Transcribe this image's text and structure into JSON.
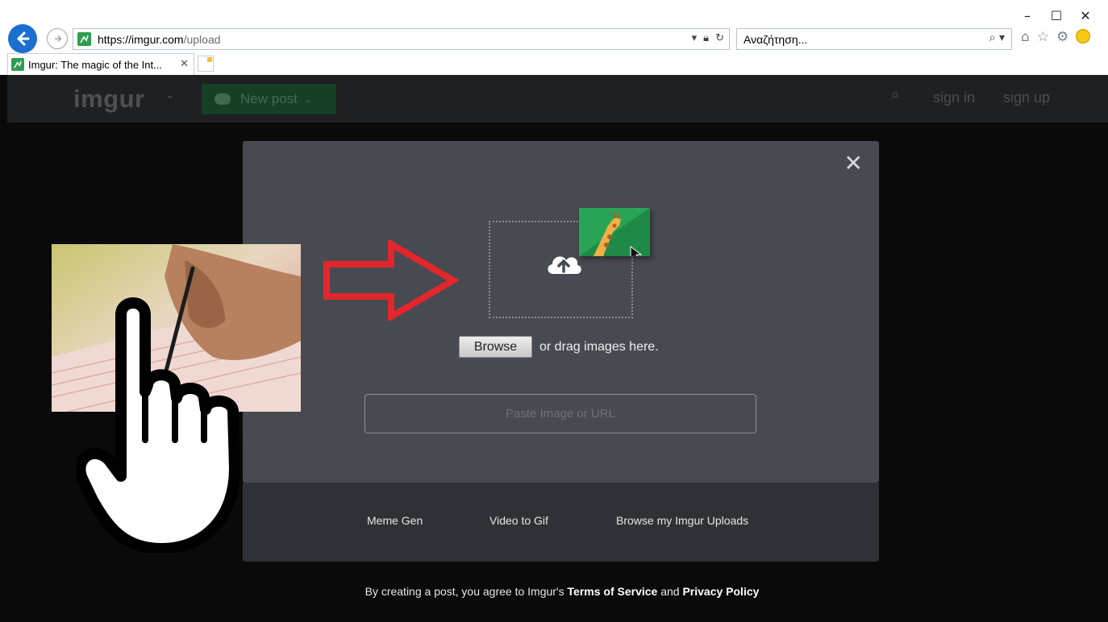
{
  "browser": {
    "window_controls": {
      "minimize": "–",
      "maximize": "☐",
      "close": "✕"
    },
    "url_main": "https://imgur.com",
    "url_path": "/upload",
    "search_placeholder": "Αναζήτηση...",
    "tab_title": "Imgur: The magic of the Int...",
    "tab_close": "✕"
  },
  "topbar": {
    "logo": "imgur",
    "new_post_label": "New post",
    "sign_in": "sign in",
    "sign_up": "sign up"
  },
  "upload_modal": {
    "close_symbol": "✕",
    "browse_button": "Browse",
    "drag_text": "or drag images here.",
    "url_placeholder": "Paste Image or URL",
    "footer_links": [
      "Meme Gen",
      "Video to Gif",
      "Browse my Imgur Uploads"
    ]
  },
  "terms": {
    "prefix": "By creating a post, you agree to Imgur's",
    "terms_link": "Terms of Service",
    "and": "and",
    "privacy_link": "Privacy Policy"
  },
  "colors": {
    "page_bg": "#0a0a0a",
    "topbar_bg": "#1f2022",
    "modal_bg": "#474a51",
    "modal_footer_bg": "#2f3136",
    "new_post_bg": "#173f26",
    "arrow_red": "#e3262b",
    "thumbnail_green": "#29a456"
  },
  "icons": [
    "back-arrow-icon",
    "forward-arrow-icon",
    "site-favicon-icon",
    "lock-icon",
    "refresh-icon",
    "search-icon",
    "home-icon",
    "star-icon",
    "gear-icon",
    "smiley-icon",
    "cloud-upload-icon",
    "giraffe-icon",
    "pointer-cursor-icon",
    "hand-pointer-icon"
  ]
}
